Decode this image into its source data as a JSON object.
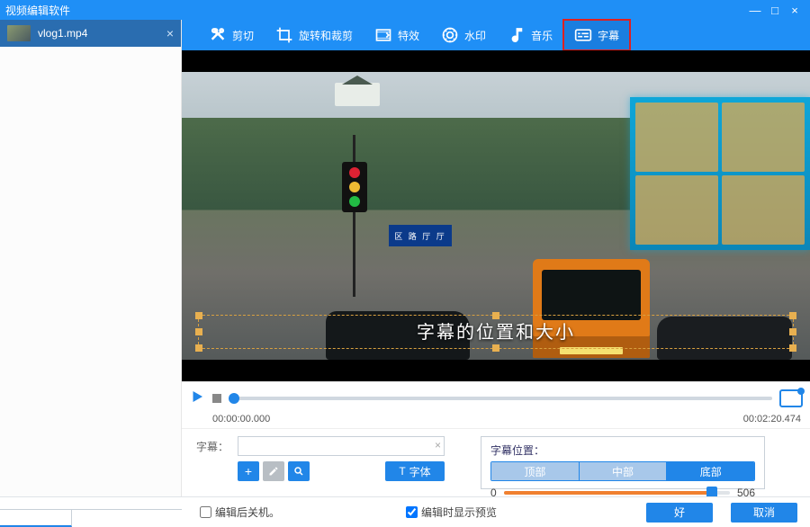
{
  "window": {
    "title": "视频编辑软件"
  },
  "file": {
    "name": "vlog1.mp4"
  },
  "toolbar": {
    "cut": "剪切",
    "rotate": "旋转和裁剪",
    "effects": "特效",
    "watermark": "水印",
    "music": "音乐",
    "subtitle": "字幕"
  },
  "preview": {
    "subtitle_sample": "字幕的位置和大小",
    "sign_text": "区 路 厅 厅"
  },
  "playback": {
    "start_time": "00:00:00.000",
    "end_time": "00:02:20.474"
  },
  "subtitle_input": {
    "label": "字幕：",
    "font_button": "字体"
  },
  "position": {
    "title": "字幕位置：",
    "top": "顶部",
    "middle": "中部",
    "bottom": "底部",
    "min": "0",
    "max": "506"
  },
  "footer": {
    "shutdown": "编辑后关机。",
    "preview_on_edit": "编辑时显示预览",
    "ok": "好",
    "cancel": "取消"
  }
}
